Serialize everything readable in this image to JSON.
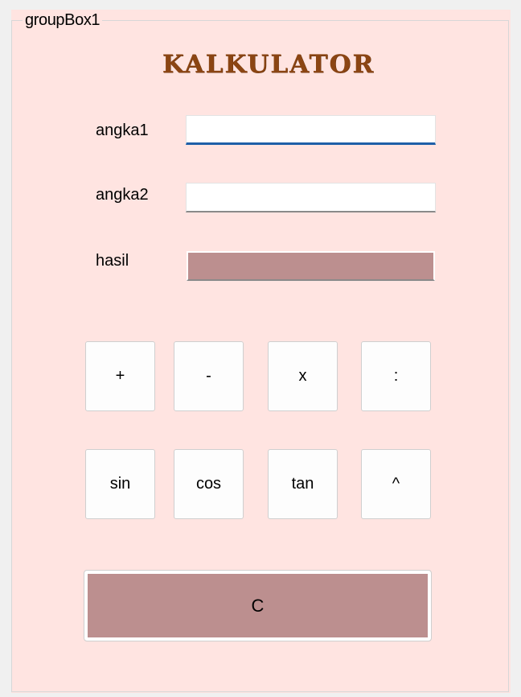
{
  "groupbox": {
    "legend": "groupBox1"
  },
  "title": "KALKULATOR",
  "fields": {
    "angka1": {
      "label": "angka1",
      "value": ""
    },
    "angka2": {
      "label": "angka2",
      "value": ""
    },
    "hasil": {
      "label": "hasil",
      "value": ""
    }
  },
  "buttons": {
    "row1": [
      "+",
      "-",
      "x",
      ":"
    ],
    "row2": [
      "sin",
      "cos",
      "tan",
      "^"
    ],
    "clear": "C"
  },
  "colors": {
    "form_background": "#ffe4e1",
    "title": "#8b4513",
    "result_and_clear": "#bc8f8f",
    "focus_underline": "#1f5fa8"
  }
}
